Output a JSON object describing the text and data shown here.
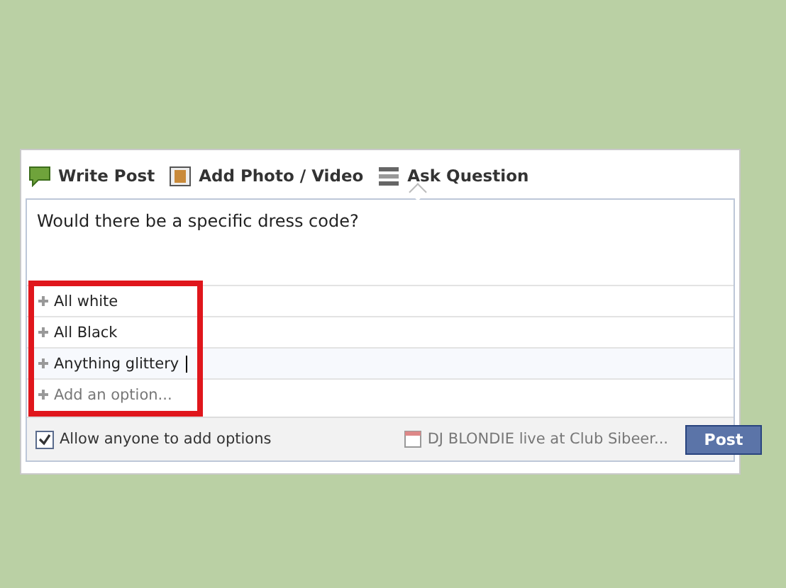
{
  "tabs": [
    {
      "label": "Write Post",
      "kind": "post",
      "selected": false
    },
    {
      "label": "Add Photo / Video",
      "kind": "photo",
      "selected": false
    },
    {
      "label": "Ask Question",
      "kind": "question",
      "selected": true
    }
  ],
  "question": {
    "value": "Would there be a specific dress code?"
  },
  "options": [
    {
      "text": "All white",
      "kind": "value",
      "focused": false
    },
    {
      "text": "All Black",
      "kind": "value",
      "focused": false
    },
    {
      "text": "Anything glittery",
      "kind": "value",
      "focused": true
    },
    {
      "text": "Add an option...",
      "kind": "placeholder",
      "focused": false
    }
  ],
  "footer": {
    "allow_others": {
      "label": "Allow anyone to add options",
      "checked": true
    },
    "event": "DJ BLONDIE live at Club Sibeer...",
    "button": "Post"
  }
}
